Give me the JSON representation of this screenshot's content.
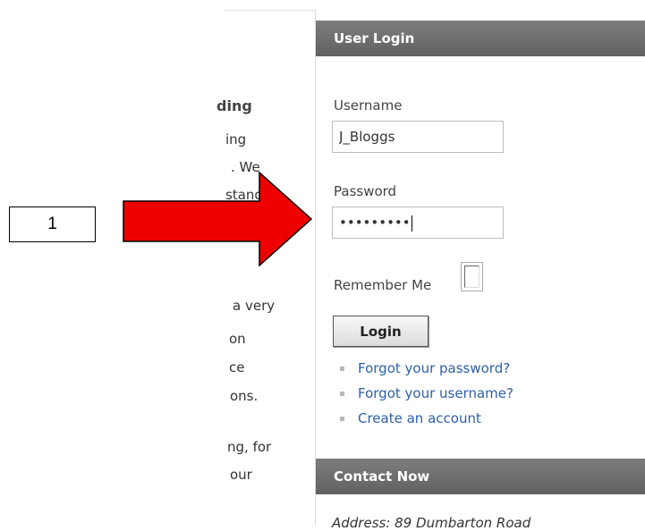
{
  "left_column": {
    "heading_fragment": "ding",
    "lines": [
      "ing",
      ". We",
      "stand",
      "a very",
      "on",
      "ce",
      "ons.",
      "ng, for",
      "our"
    ]
  },
  "callout": {
    "number": "1",
    "arrow_color": "#ee0000"
  },
  "login_panel": {
    "title": "User Login",
    "username_label": "Username",
    "username_value": "J_Bloggs",
    "password_label": "Password",
    "password_value": "•••••••••",
    "remember_label": "Remember Me",
    "remember_checked": false,
    "login_button": "Login",
    "links": [
      "Forgot your password?",
      "Forgot your username?",
      "Create an account"
    ]
  },
  "contact_panel": {
    "title": "Contact Now",
    "address_label": "Address:",
    "address_value": "89 Dumbarton Road"
  },
  "colors": {
    "header_bg": "#6e6e6e",
    "link": "#2e5fa7",
    "arrow": "#ee0000"
  }
}
